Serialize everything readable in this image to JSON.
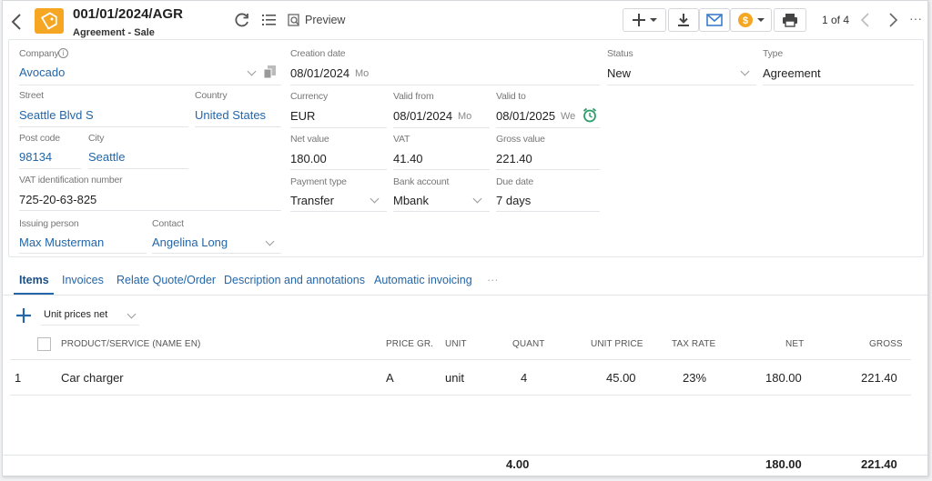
{
  "header": {
    "doc_number": "001/01/2024/AGR",
    "doc_type": "Agreement - Sale",
    "preview_label": "Preview",
    "pager": "1 of 4",
    "more": "···"
  },
  "form": {
    "company": {
      "label": "Company",
      "value": "Avocado"
    },
    "creation_date": {
      "label": "Creation date",
      "value": "08/01/2024",
      "weekday": "Mo"
    },
    "status": {
      "label": "Status",
      "value": "New"
    },
    "type": {
      "label": "Type",
      "value": "Agreement"
    },
    "street": {
      "label": "Street",
      "value": "Seattle Blvd S"
    },
    "country": {
      "label": "Country",
      "value": "United States"
    },
    "currency": {
      "label": "Currency",
      "value": "EUR"
    },
    "valid_from": {
      "label": "Valid from",
      "value": "08/01/2024",
      "weekday": "Mo"
    },
    "valid_to": {
      "label": "Valid to",
      "value": "08/01/2025",
      "weekday": "We"
    },
    "post_code": {
      "label": "Post code",
      "value": "98134"
    },
    "city": {
      "label": "City",
      "value": "Seattle"
    },
    "net_value": {
      "label": "Net value",
      "value": "180.00"
    },
    "vat": {
      "label": "VAT",
      "value": "41.40"
    },
    "gross_value": {
      "label": "Gross value",
      "value": "221.40"
    },
    "vat_id": {
      "label": "VAT identification number",
      "value": "725-20-63-825"
    },
    "payment_type": {
      "label": "Payment type",
      "value": "Transfer"
    },
    "bank_account": {
      "label": "Bank account",
      "value": "Mbank"
    },
    "due_date": {
      "label": "Due date",
      "value": "7 days"
    },
    "issuing_person": {
      "label": "Issuing person",
      "value": "Max Musterman"
    },
    "contact": {
      "label": "Contact",
      "value": "Angelina Long"
    }
  },
  "tabs": [
    {
      "label": "Items"
    },
    {
      "label": "Invoices"
    },
    {
      "label": "Relate Quote/Order"
    },
    {
      "label": "Description and annotations"
    },
    {
      "label": "Automatic invoicing"
    },
    {
      "label": "···"
    }
  ],
  "items": {
    "price_mode": "Unit prices net",
    "columns": [
      "PRODUCT/SERVICE (NAME EN)",
      "PRICE GR.",
      "UNIT",
      "QUANT",
      "UNIT PRICE",
      "TAX RATE",
      "NET",
      "GROSS"
    ],
    "rows": [
      {
        "no": "1",
        "product": "Car charger",
        "price_group": "A",
        "unit": "unit",
        "quantity": "4",
        "unit_price": "45.00",
        "tax_rate": "23%",
        "net": "180.00",
        "gross": "221.40"
      }
    ],
    "totals": {
      "quantity": "4.00",
      "net": "180.00",
      "gross": "221.40"
    }
  },
  "colors": {
    "accent": "#f5a623",
    "link": "#2466a8",
    "alarm": "#2e9e6a"
  }
}
